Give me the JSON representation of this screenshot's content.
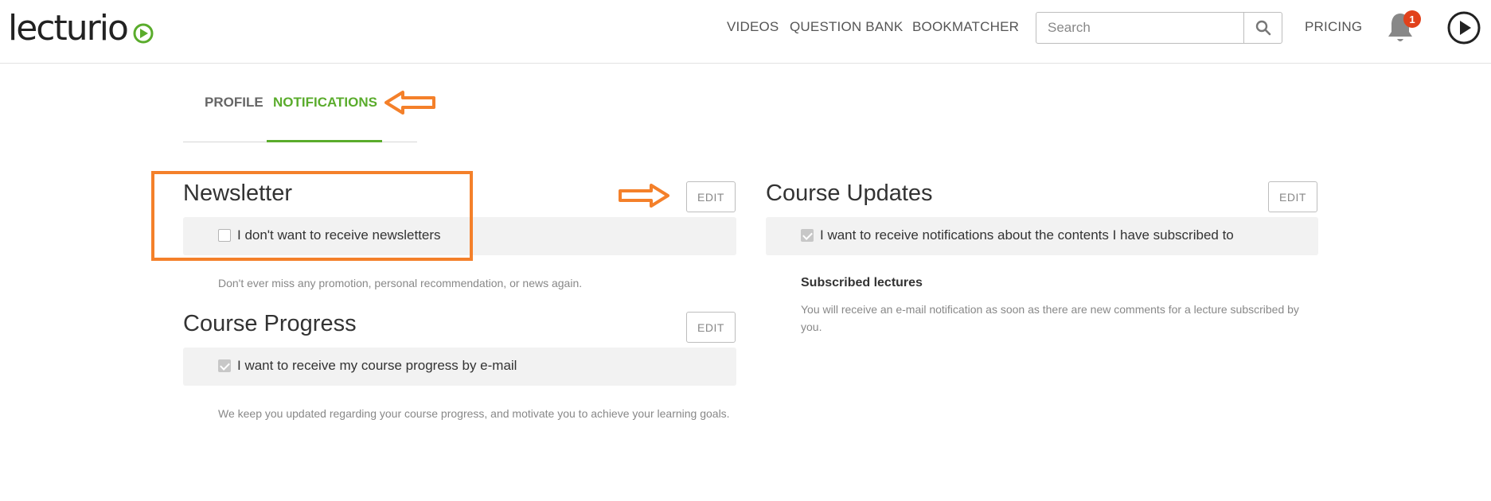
{
  "header": {
    "logo_text": "lecturio",
    "nav": {
      "videos": "VIDEOS",
      "question_bank": "QUESTION BANK",
      "bookmatcher": "BOOKMATCHER",
      "pricing": "PRICING"
    },
    "search": {
      "placeholder": "Search"
    },
    "notifications_count": "1"
  },
  "tabs": {
    "profile": "PROFILE",
    "notifications": "NOTIFICATIONS",
    "active": "notifications"
  },
  "newsletter": {
    "title": "Newsletter",
    "edit_label": "EDIT",
    "option_label": "I don't want to receive newsletters",
    "checked": false,
    "description": "Don't ever miss any promotion, personal recommendation, or news again."
  },
  "course_progress": {
    "title": "Course Progress",
    "edit_label": "EDIT",
    "option_label": "I want to receive my course progress by e-mail",
    "checked": true,
    "description": "We keep you updated regarding your course progress, and motivate you to achieve your learning goals."
  },
  "course_updates": {
    "title": "Course Updates",
    "edit_label": "EDIT",
    "option_label": "I want to receive notifications about the contents I have subscribed to",
    "checked": true,
    "subscribed_heading": "Subscribed lectures",
    "subscribed_description": "You will receive an e-mail notification as soon as there are new comments for a lecture subscribed by you."
  },
  "colors": {
    "brand_green": "#5aac2c",
    "annotation_orange": "#f4802a",
    "badge_red": "#e1411b"
  },
  "icons": [
    "lecturio-logo",
    "search-icon",
    "bell-icon",
    "play-circle-icon",
    "arrow-left-annotation",
    "arrow-right-annotation"
  ]
}
